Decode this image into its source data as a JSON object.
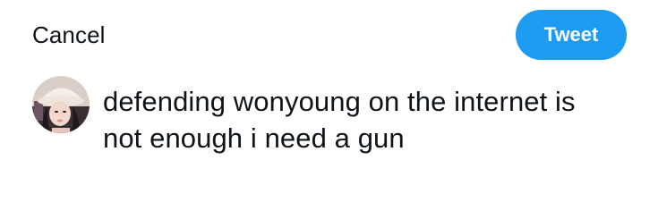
{
  "header": {
    "cancel_label": "Cancel",
    "tweet_label": "Tweet"
  },
  "composer": {
    "text_line_1": "defending wonyoung on the internet is",
    "text_line_2": "not enough i need a gun"
  },
  "colors": {
    "accent": "#1d9bf0",
    "text": "#0f1419",
    "background": "#ffffff"
  }
}
